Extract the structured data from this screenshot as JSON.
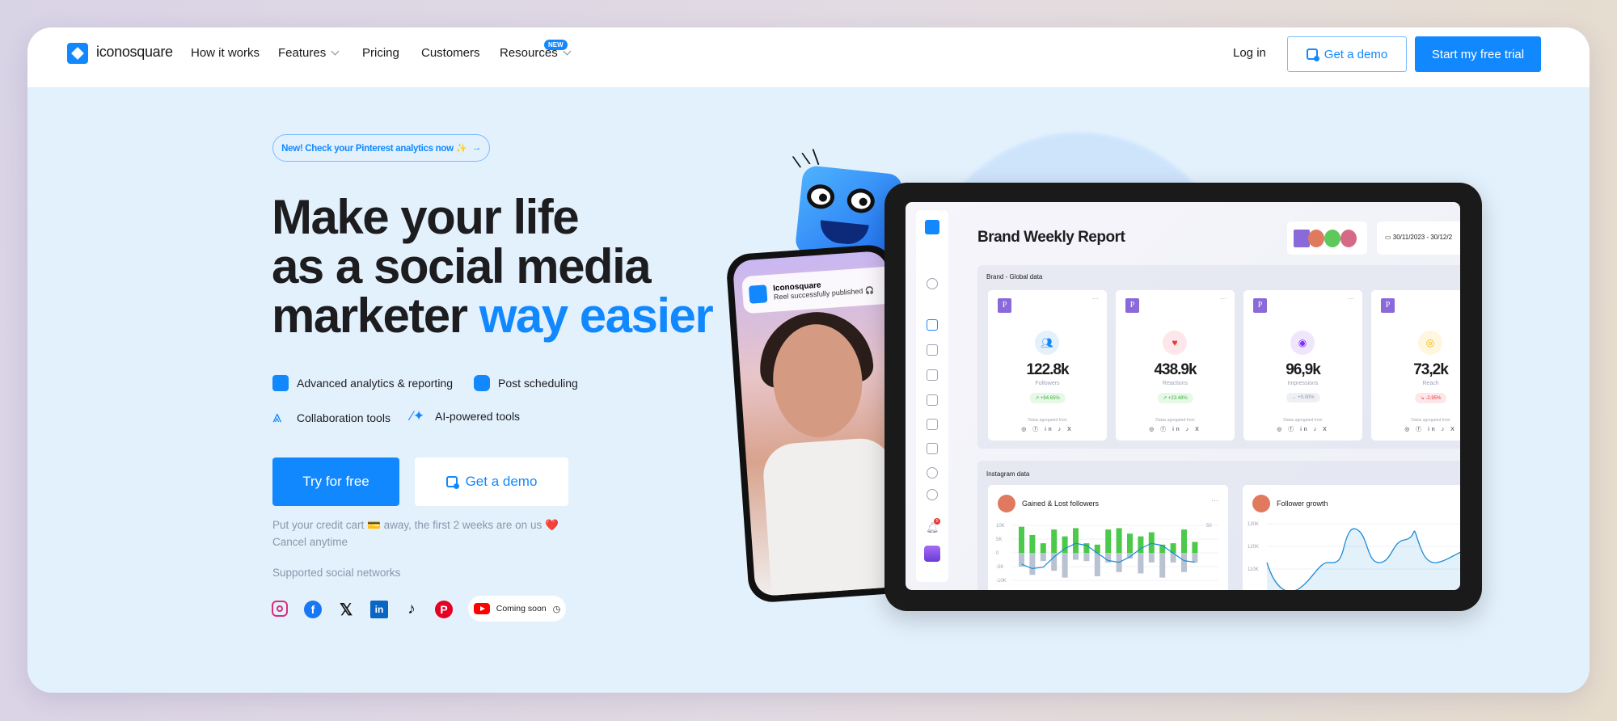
{
  "nav": {
    "brand": "iconosquare",
    "items": [
      {
        "label": "How it works",
        "dropdown": false
      },
      {
        "label": "Features",
        "dropdown": true
      },
      {
        "label": "Pricing",
        "dropdown": false
      },
      {
        "label": "Customers",
        "dropdown": false
      },
      {
        "label": "Resources",
        "dropdown": true,
        "badge": "NEW"
      }
    ],
    "login": "Log in",
    "demo": "Get a demo",
    "trial": "Start my free trial"
  },
  "hero": {
    "announcement": "New! Check your Pinterest analytics now ✨",
    "announcement_arrow": "→",
    "headline_1": "Make your life",
    "headline_2": "as a social media",
    "headline_3": "marketer",
    "headline_highlight": "way easier",
    "features": [
      {
        "label": "Advanced analytics & reporting",
        "icon": "chart-icon"
      },
      {
        "label": "Post scheduling",
        "icon": "calendar-icon"
      },
      {
        "label": "Collaboration tools",
        "icon": "network-icon"
      },
      {
        "label": "AI-powered tools",
        "icon": "magic-wand-icon"
      }
    ],
    "try_button": "Try for free",
    "demo_button": "Get a demo",
    "note_1": "Put your credit cart 💳 away, the first 2 weeks are on us ❤️",
    "note_2": "Cancel anytime",
    "networks_label": "Supported social networks",
    "networks": [
      "instagram",
      "facebook",
      "x",
      "linkedin",
      "tiktok",
      "pinterest"
    ],
    "coming_soon": "Coming soon",
    "coming_soon_network": "youtube"
  },
  "phone": {
    "app": "Iconosquare",
    "message": "Reel successfully published 🎧"
  },
  "dashboard": {
    "title": "Brand Weekly Report",
    "date_range": "30/11/2023 - 30/12/2",
    "global_section": "Brand - Global data",
    "metrics": [
      {
        "value": "122.8k",
        "label": "Followers",
        "change": "↗ +94.65%",
        "trend": "up",
        "icon": "users-icon"
      },
      {
        "value": "438.9k",
        "label": "Reactions",
        "change": "↗ +23.48%",
        "trend": "up",
        "icon": "heart-icon"
      },
      {
        "value": "96,9k",
        "label": "Impressions",
        "change": "→ +0.00%",
        "trend": "flat",
        "icon": "eye-icon"
      },
      {
        "value": "73,2k",
        "label": "Reach",
        "change": "↘ -2.95%",
        "trend": "down",
        "icon": "target-icon"
      }
    ],
    "aggregated_label": "Datas agregated from",
    "aggregated_networks": "◎ ⓕ in ♪ X",
    "instagram_section": "Instagram data",
    "gained_lost": {
      "title": "Gained & Lost followers",
      "y_ticks": [
        "10K",
        "5K",
        "0",
        "-5K",
        "-10K"
      ],
      "y2_tick": "50",
      "gained": [
        9.5,
        6.5,
        3.5,
        8.5,
        6,
        9,
        3.5,
        3,
        8.5,
        9,
        7,
        6,
        7.5,
        3,
        3.5,
        8.5,
        4
      ],
      "lost": [
        -5,
        -8,
        -3,
        -6.5,
        -9,
        -2.5,
        -3,
        -8.5,
        -3.5,
        -7,
        -2,
        -7.5,
        -3.5,
        -9,
        -3.5,
        -7,
        -3.5
      ],
      "colors": {
        "gained": "#4cc94a",
        "lost": "#b9c2d0",
        "line": "#1c8ad6"
      }
    },
    "follower_growth": {
      "title": "Follower growth",
      "y_ticks": [
        "130K",
        "120K",
        "110K"
      ]
    },
    "notification_count": "0"
  },
  "colors": {
    "accent": "#1288ff",
    "background": "#e3f1fd",
    "dark": "#1d1d1f"
  }
}
